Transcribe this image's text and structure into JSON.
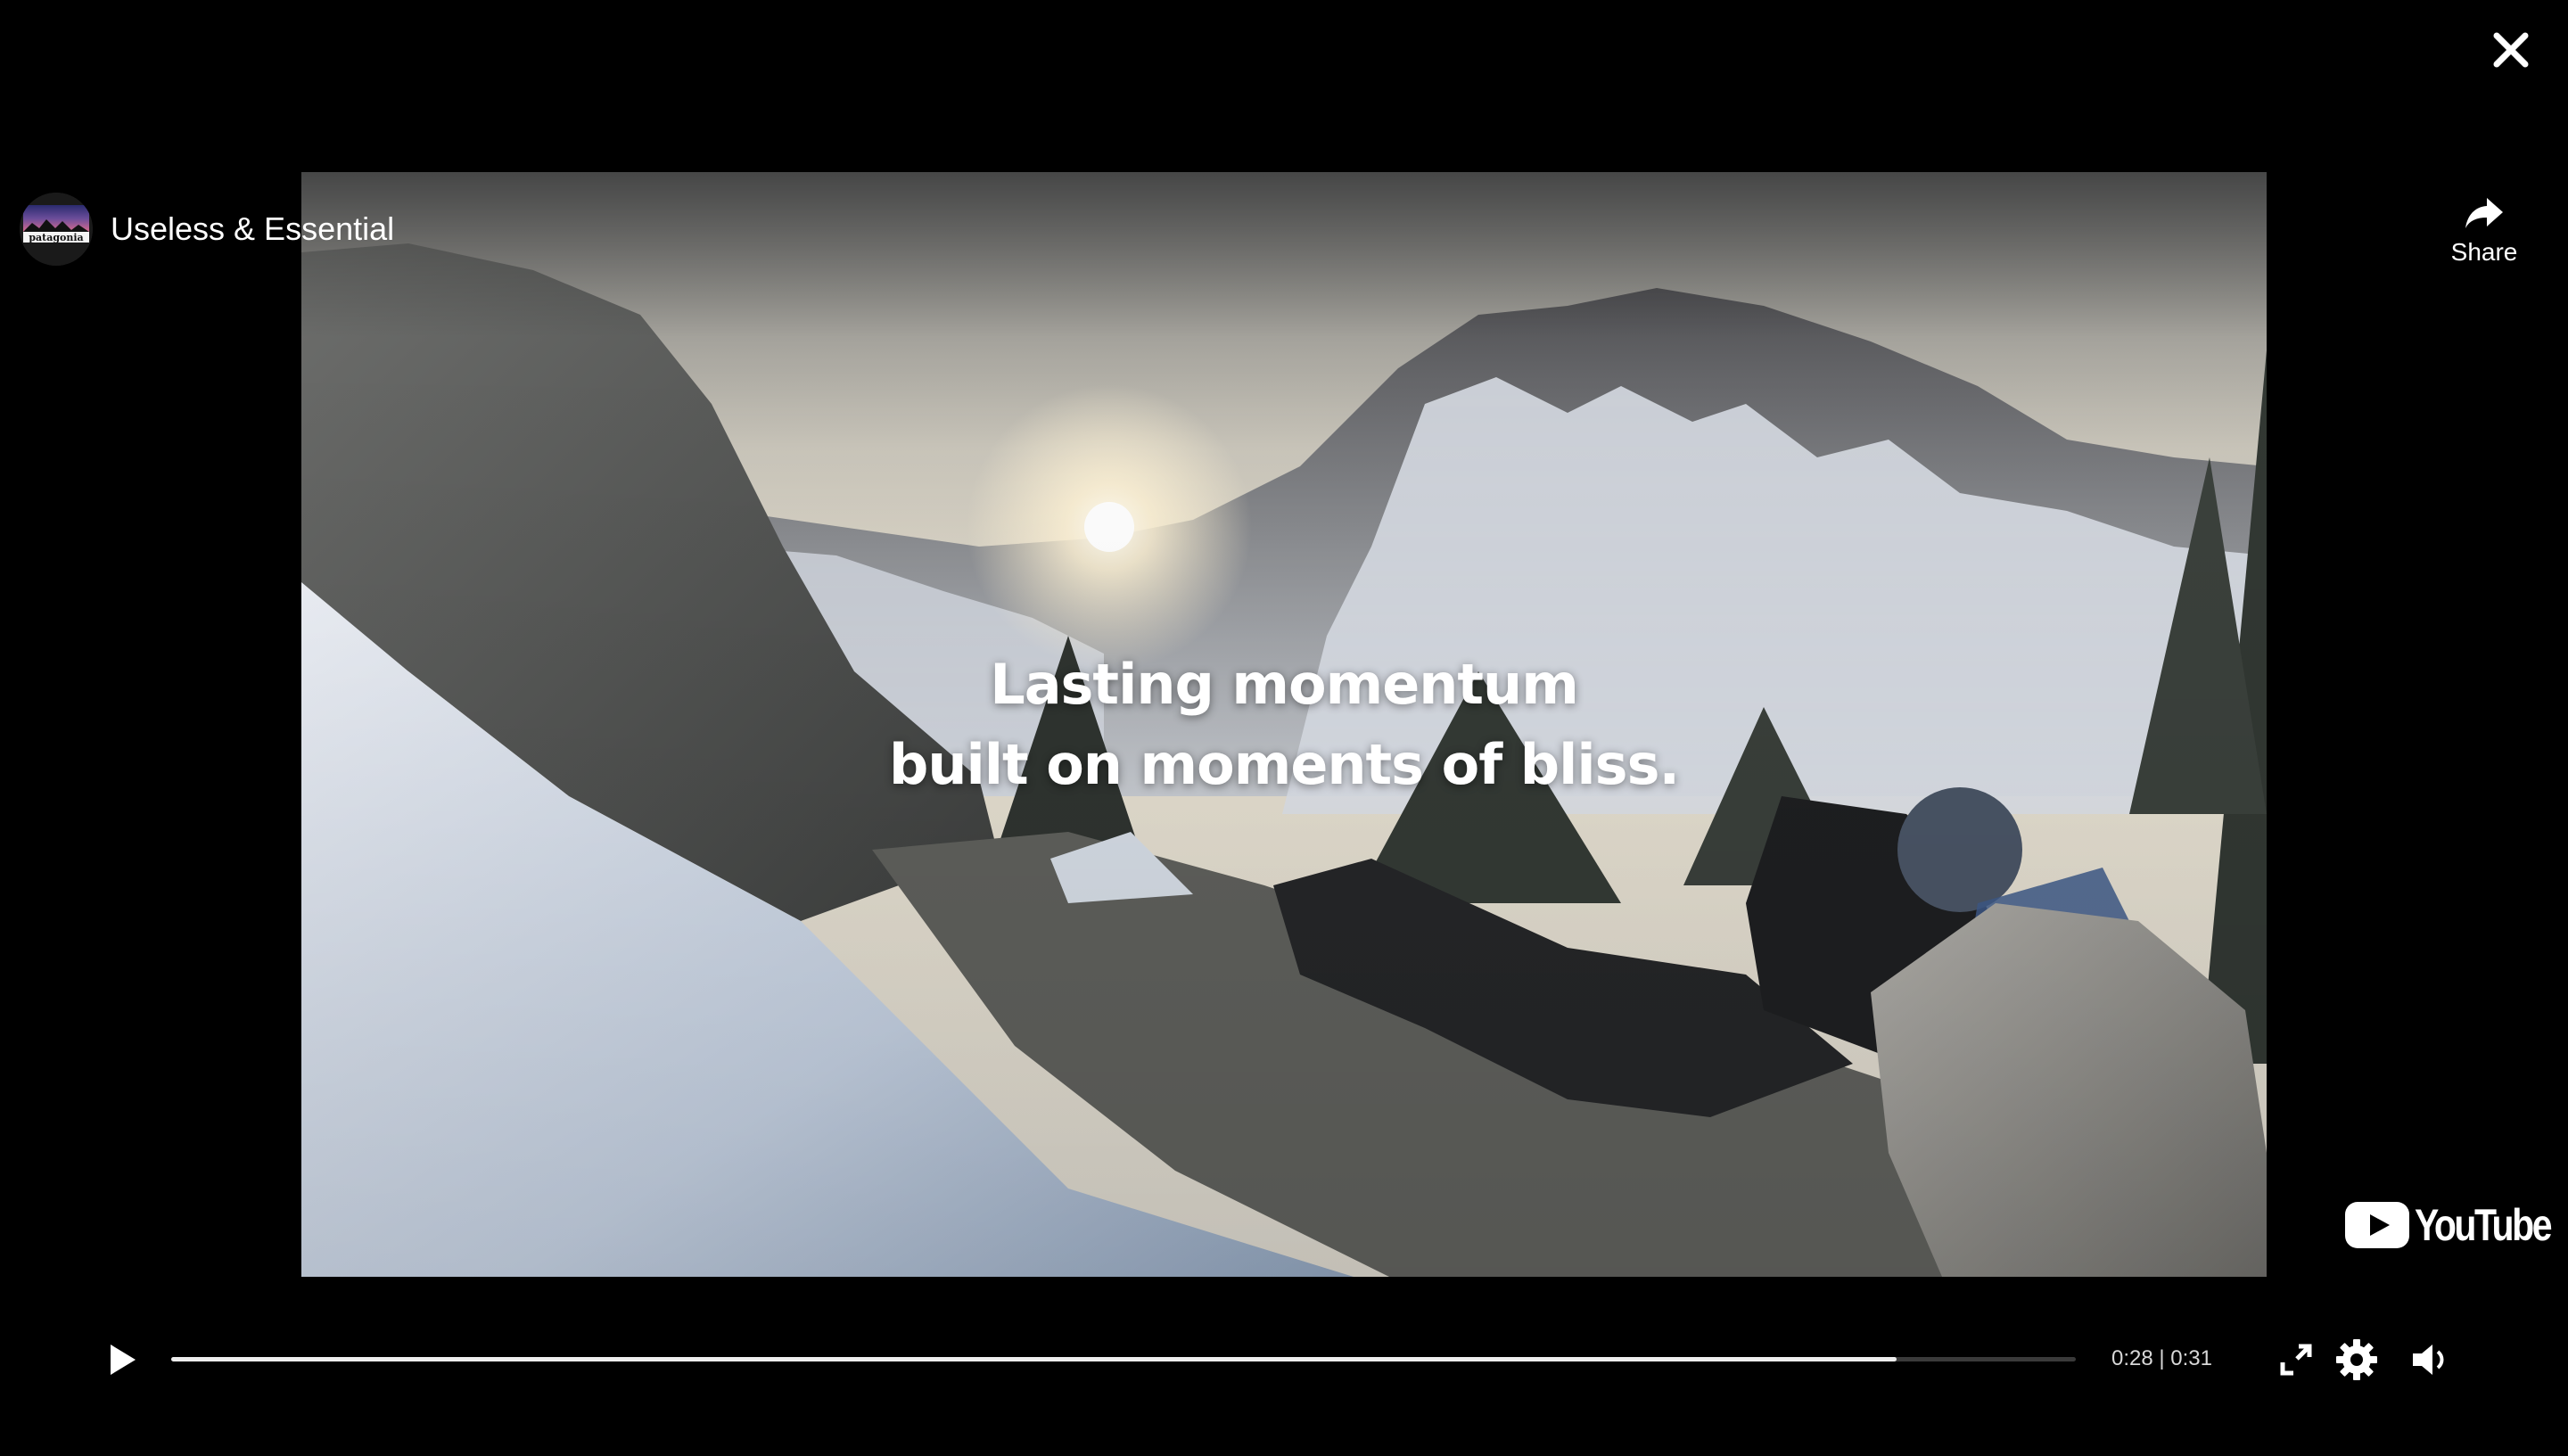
{
  "player": {
    "channel_name": "Useless & Essential",
    "avatar_text": "patagonia",
    "close_icon": "close-icon",
    "share_label": "Share",
    "share_icon": "share-arrow-icon",
    "caption_line1": "Lasting momentum",
    "caption_line2": "built on moments of bliss.",
    "brand_logo_text": "YouTube"
  },
  "controls": {
    "play_icon": "play-icon",
    "progress": 0.906,
    "time_display": "0:28 | 0:31",
    "fullscreen_icon": "fullscreen-icon",
    "settings_icon": "gear-icon",
    "volume_icon": "volume-icon"
  },
  "colors": {
    "background": "#000000",
    "progress_fill": "#ededed",
    "progress_track": "#3a3a3a",
    "youtube_red": "#ffffff"
  }
}
